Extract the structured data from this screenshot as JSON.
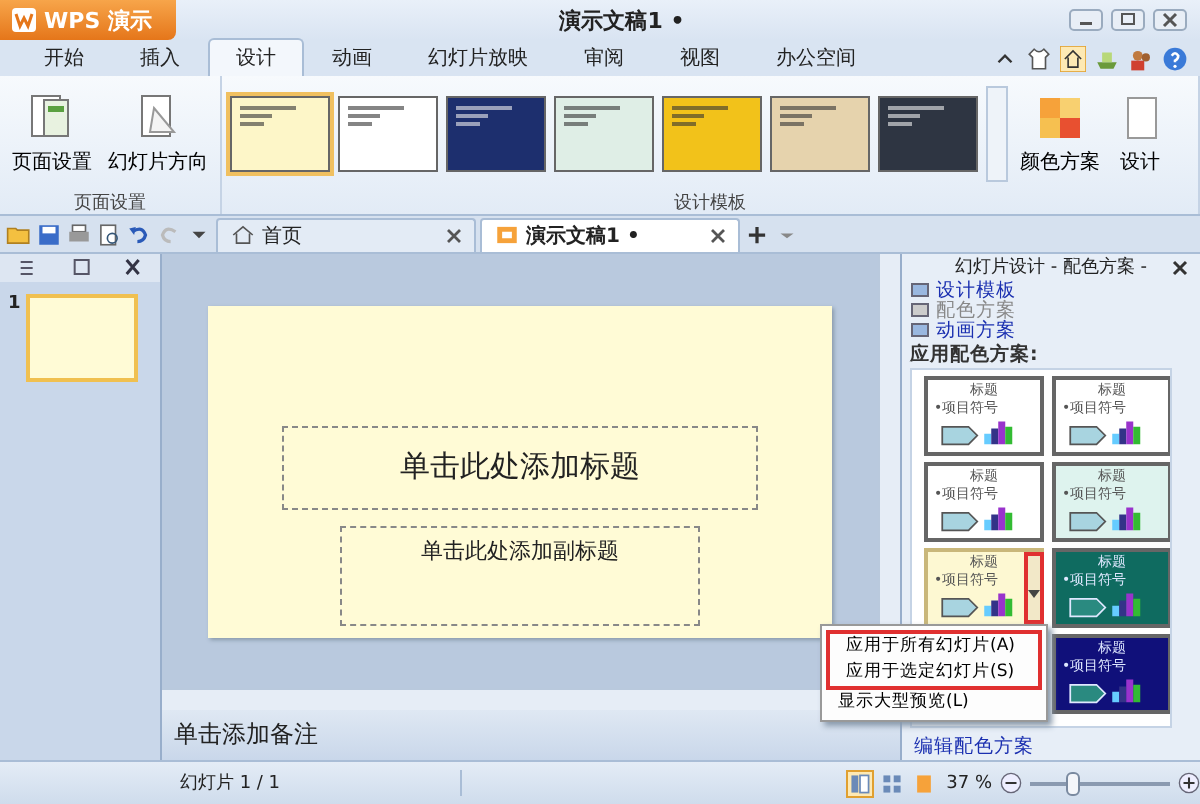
{
  "app_button": {
    "label": "WPS 演示"
  },
  "window": {
    "title": "演示文稿1 •"
  },
  "tabs": [
    {
      "label": "开始",
      "selected": false
    },
    {
      "label": "插入",
      "selected": false
    },
    {
      "label": "设计",
      "selected": true
    },
    {
      "label": "动画",
      "selected": false
    },
    {
      "label": "幻灯片放映",
      "selected": false
    },
    {
      "label": "审阅",
      "selected": false
    },
    {
      "label": "视图",
      "selected": false
    },
    {
      "label": "办公空间",
      "selected": false
    }
  ],
  "ribbon": {
    "groups": [
      {
        "label": "页面设置",
        "buttons": [
          "页面设置",
          "幻灯片方向"
        ]
      },
      {
        "label": "设计模板",
        "templates": [
          {
            "color": "#fdf6c8",
            "selected": true
          },
          {
            "color": "#ffffff",
            "selected": false
          },
          {
            "color": "#1d2f6e",
            "selected": false
          },
          {
            "color": "#dfeee6",
            "selected": false
          },
          {
            "color": "#f2c21a",
            "selected": false
          },
          {
            "color": "#e6d3ad",
            "selected": false
          },
          {
            "color": "#2e3542",
            "selected": false
          }
        ],
        "buttons": [
          "颜色方案",
          "设计"
        ]
      }
    ]
  },
  "doc_tabs": [
    {
      "label": "首页",
      "selected": false
    },
    {
      "label": "演示文稿1 •",
      "selected": true
    }
  ],
  "slides_pane": {
    "thumbnails": [
      {
        "number": "1",
        "selected": true
      }
    ]
  },
  "slide": {
    "title_placeholder": "单击此处添加标题",
    "subtitle_placeholder": "单击此处添加副标题"
  },
  "notes": {
    "placeholder": "单击添加备注"
  },
  "task_pane": {
    "title": "幻灯片设计 - 配色方案 -",
    "links": [
      {
        "label": "设计模板",
        "disabled": false
      },
      {
        "label": "配色方案",
        "disabled": true
      },
      {
        "label": "动画方案",
        "disabled": false
      }
    ],
    "section_label": "应用配色方案:",
    "schemes": [
      {
        "title": "标题",
        "bullet": "•项目符号",
        "color": "#ffffff",
        "selected": false
      },
      {
        "title": "标题",
        "bullet": "•项目符号",
        "color": "#ffffff",
        "selected": false
      },
      {
        "title": "标题",
        "bullet": "•项目符号",
        "color": "#ffffff",
        "selected": false
      },
      {
        "title": "标题",
        "bullet": "•项目符号",
        "color": "#def3ee",
        "selected": false
      },
      {
        "title": "标题",
        "bullet": "•项目符号",
        "color": "#fdf8d2",
        "selected": true
      },
      {
        "title": "标题",
        "bullet": "•项目符号",
        "color": "#0f6b60",
        "selected": false
      },
      {
        "title": "标题",
        "bullet": "•项目符号",
        "color": "#10107a",
        "selected": false
      }
    ],
    "footer_link": "编辑配色方案"
  },
  "context_menu": {
    "items": [
      {
        "label": "应用于所有幻灯片(A)",
        "highlighted": true
      },
      {
        "label": "应用于选定幻灯片(S)",
        "highlighted": true
      },
      {
        "label": "显示大型预览(L)",
        "highlighted": false
      }
    ]
  },
  "status_bar": {
    "slide_info": "幻灯片 1 / 1",
    "views": [
      {
        "selected": true
      },
      {
        "selected": false
      },
      {
        "selected": false
      }
    ],
    "zoom": "37 %",
    "zoom_slider": {
      "level": 0.3
    }
  }
}
